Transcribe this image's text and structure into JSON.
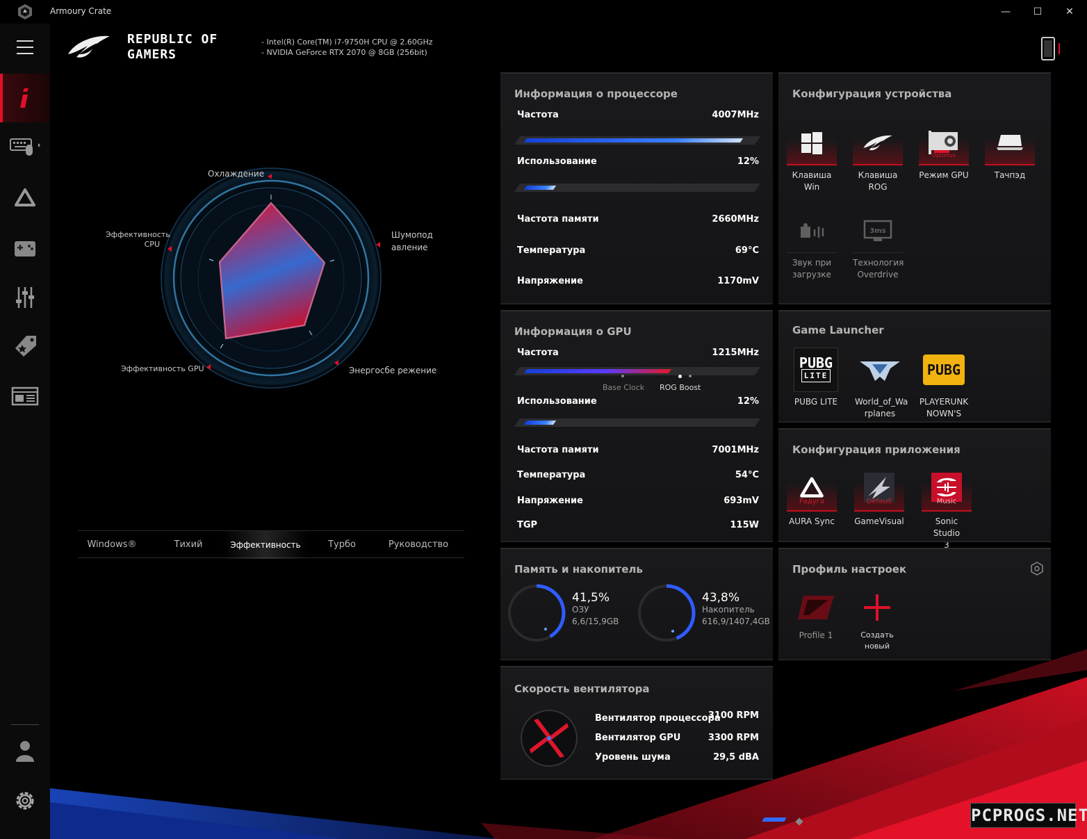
{
  "window": {
    "title": "Armoury Crate",
    "minimize": "—",
    "maximize": "☐",
    "close": "✕"
  },
  "header": {
    "brand_line1": "REPUBLIC OF",
    "brand_line2": "GAMERS",
    "cpu_spec": "-   Intel(R) Core(TM) i7-9750H CPU @ 2.60GHz",
    "gpu_spec": "-   NVIDIA GeForce RTX 2070 @ 8GB (256bit)"
  },
  "sidebar": {
    "items": [
      {
        "name": "info",
        "icon": "info-icon",
        "active": true
      },
      {
        "name": "keyboard",
        "icon": "keyboard-mouse-icon"
      },
      {
        "name": "aura",
        "icon": "aura-icon"
      },
      {
        "name": "game",
        "icon": "gamepad-icon"
      },
      {
        "name": "tuning",
        "icon": "sliders-icon"
      },
      {
        "name": "deals",
        "icon": "tag-icon"
      },
      {
        "name": "news",
        "icon": "news-icon"
      }
    ],
    "bottom": [
      {
        "name": "user",
        "icon": "user-icon"
      },
      {
        "name": "settings",
        "icon": "gear-icon"
      }
    ]
  },
  "radar": {
    "labels": {
      "cooling": "Охлаждение",
      "noise_1": "Шумопод",
      "noise_2": "авление",
      "power": "Энергосбе режение",
      "gpu_perf": "Эффективность GPU",
      "cpu_perf_1": "Эффективность",
      "cpu_perf_2": "CPU"
    },
    "values": {
      "cooling": 0.85,
      "noise": 0.8,
      "power": 0.75,
      "gpu_perf": 0.72,
      "cpu_perf": 0.72
    }
  },
  "modes": {
    "items": [
      "Windows®",
      "Тихий",
      "Эффективность",
      "Турбо",
      "Руководство"
    ],
    "active": "Эффективность"
  },
  "cpu_panel": {
    "title": "Информация о процессоре",
    "freq_label": "Частота",
    "freq_value": "4007MHz",
    "freq_level": 0.9,
    "usage_label": "Использование",
    "usage_value": "12%",
    "usage_level": 0.12,
    "mem_freq_label": "Частота памяти",
    "mem_freq_value": "2660MHz",
    "temp_label": "Температура",
    "temp_value": "69°C",
    "volt_label": "Напряжение",
    "volt_value": "1170mV"
  },
  "gpu_panel": {
    "title": "Информация о GPU",
    "freq_label": "Частота",
    "freq_value": "1215MHz",
    "freq_level": 0.6,
    "base_clock": "Base Clock",
    "rog_boost": "ROG Boost",
    "usage_label": "Использование",
    "usage_value": "12%",
    "usage_level": 0.12,
    "mem_freq_label": "Частота памяти",
    "mem_freq_value": "7001MHz",
    "temp_label": "Температура",
    "temp_value": "54°C",
    "volt_label": "Напряжение",
    "volt_value": "693mV",
    "tgp_label": "TGP",
    "tgp_value": "115W"
  },
  "memory_panel": {
    "title": "Память и накопитель",
    "ram_percent": "41,5%",
    "ram_label": "ОЗУ",
    "ram_detail": "6,6/15,9GB",
    "ram_level": 0.415,
    "disk_percent": "43,8%",
    "disk_label": "Накопитель",
    "disk_detail": "616,9/1407,4GB",
    "disk_level": 0.438
  },
  "fan_panel": {
    "title": "Скорость вентилятора",
    "cpu_fan_label": "Вентилятор процессора",
    "cpu_fan_value": "3100  RPM",
    "gpu_fan_label": "Вентилятор GPU",
    "gpu_fan_value": "3300  RPM",
    "noise_label": "Уровень шума",
    "noise_value": "29,5  dBA"
  },
  "device_panel": {
    "title": "Конфигурация устройства",
    "win_key_1": "Клавиша",
    "win_key_2": "Win",
    "rog_key_1": "Клавиша",
    "rog_key_2": "ROG",
    "gpu_mode": "Режим GPU",
    "gpu_mode_sub": "Optimus",
    "touchpad": "Тачпэд",
    "boot_sound_1": "Звук при",
    "boot_sound_2": "загрузке",
    "overdrive_1": "Технология",
    "overdrive_2": "Overdrive",
    "overdrive_icon_text": "3ms"
  },
  "game_launcher": {
    "title": "Game Launcher",
    "games": [
      {
        "name_1": "PUBG LITE",
        "name_2": "",
        "icon": "pubg-lite-icon"
      },
      {
        "name_1": "World_of_Wa",
        "name_2": "rplanes",
        "icon": "world-of-warplanes-icon"
      },
      {
        "name_1": "PLAYERUNK",
        "name_2": "NOWN'S",
        "icon": "pubg-icon"
      }
    ],
    "pubg_lite_logo_1": "PUBG",
    "pubg_lite_logo_2": "LITE",
    "pubg_logo": "PUBG"
  },
  "app_config": {
    "title": "Конфигурация приложения",
    "aura_name": "AURA Sync",
    "aura_sub": "Радуга",
    "gamevisual_name": "GameVisual",
    "gamevisual_sub": "Default",
    "sonic_name_1": "Sonic Studio",
    "sonic_name_2": "3",
    "sonic_sub": "Music"
  },
  "profiles": {
    "title": "Профиль настроек",
    "profile1": "Profile 1",
    "create_1": "Создать",
    "create_2": "новый"
  },
  "watermark": "PCPROGS.NET",
  "colors": {
    "accent_red": "#e0102a",
    "accent_blue": "#2f6bff",
    "panel": "#18181a"
  }
}
